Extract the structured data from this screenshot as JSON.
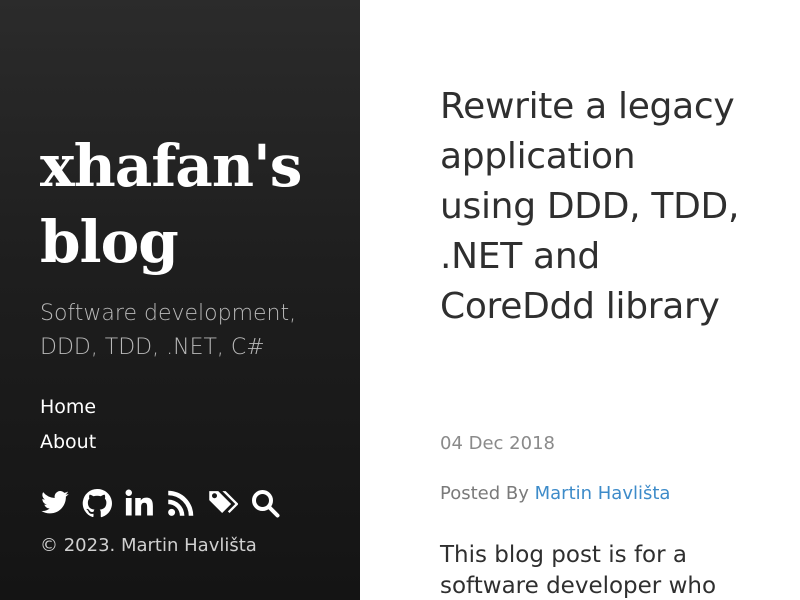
{
  "sidebar": {
    "site_title": "xhafan's blog",
    "tagline": "Software development, DDD, TDD, .NET, C#",
    "nav": [
      {
        "label": "Home"
      },
      {
        "label": "About"
      }
    ],
    "social_icons": [
      "twitter-icon",
      "github-icon",
      "linkedin-icon",
      "rss-icon",
      "tags-icon",
      "search-icon"
    ],
    "copyright": "© 2023. Martin Havlišta"
  },
  "post": {
    "title": "Rewrite a legacy application using DDD, TDD, .NET and CoreDdd library",
    "date": "04 Dec 2018",
    "posted_by_label": "Posted By",
    "author": "Martin Havlišta",
    "intro": "This blog post is for a software developer who"
  },
  "colors": {
    "sidebar_bg": "#1e1e1e",
    "link": "#3d8bc9",
    "text": "#2f2f2f",
    "muted": "#8a8a8a"
  }
}
